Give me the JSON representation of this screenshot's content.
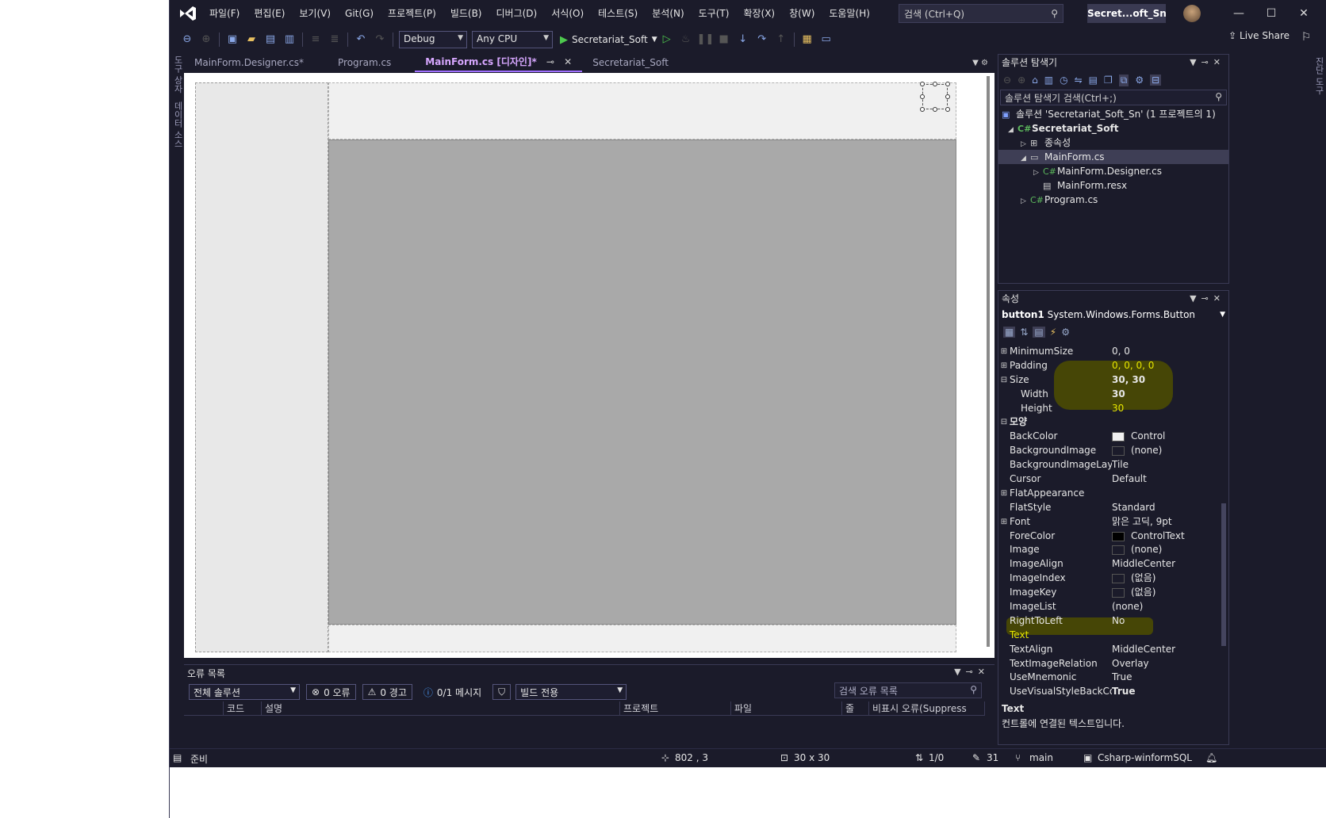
{
  "menubar": {
    "items": [
      "파일(F)",
      "편집(E)",
      "보기(V)",
      "Git(G)",
      "프로젝트(P)",
      "빌드(B)",
      "디버그(D)",
      "서식(O)",
      "테스트(S)",
      "분석(N)",
      "도구(T)",
      "확장(X)",
      "창(W)",
      "도움말(H)"
    ],
    "search_placeholder": "검색 (Ctrl+Q)",
    "solution_name": "Secret...oft_Sn"
  },
  "toolbar": {
    "configuration": "Debug",
    "platform": "Any CPU",
    "run_target": "Secretariat_Soft",
    "live_share": "Live Share"
  },
  "left_strip": {
    "toolbox": "도구 상자",
    "datasources": "데이터 소스"
  },
  "right_strip": {
    "tab": "진단 도구"
  },
  "doc_tabs": [
    {
      "label": "MainForm.Designer.cs*"
    },
    {
      "label": "Program.cs"
    },
    {
      "label": "MainForm.cs [디자인]*"
    },
    {
      "label": "Secretariat_Soft"
    }
  ],
  "error_list": {
    "title": "오류 목록",
    "scope": "전체 솔루션",
    "errors": "0 오류",
    "warnings": "0 경고",
    "messages": "0/1 메시지",
    "build_filter": "빌드 전용",
    "search_placeholder": "검색 오류 목록",
    "columns": [
      "코드",
      "설명",
      "프로젝트",
      "파일",
      "줄",
      "비표시 오류(Suppress"
    ]
  },
  "solution_explorer": {
    "title": "솔루션 탐색기",
    "search_placeholder": "솔루션 탐색기 검색(Ctrl+;)",
    "tree": [
      {
        "label": "솔루션 'Secretariat_Soft_Sn' (1 프로젝트의 1)",
        "icon": "solution-icon"
      },
      {
        "label": "Secretariat_Soft",
        "icon": "csharp-project-icon"
      },
      {
        "label": "종속성",
        "icon": "dependencies-icon"
      },
      {
        "label": "MainForm.cs",
        "icon": "form-icon"
      },
      {
        "label": "MainForm.Designer.cs",
        "icon": "csharp-file-icon"
      },
      {
        "label": "MainForm.resx",
        "icon": "resx-file-icon"
      },
      {
        "label": "Program.cs",
        "icon": "csharp-file-icon"
      }
    ]
  },
  "properties": {
    "title": "속성",
    "object_name": "button1",
    "object_type": "System.Windows.Forms.Button",
    "rows": [
      {
        "name": "MinimumSize",
        "value": "0, 0"
      },
      {
        "name": "Padding",
        "value": "0, 0, 0, 0"
      },
      {
        "name": "Size",
        "value": "30, 30"
      },
      {
        "name": "Width",
        "value": "30"
      },
      {
        "name": "Height",
        "value": "30"
      },
      {
        "name": "모양",
        "value": ""
      },
      {
        "name": "BackColor",
        "value": "Control"
      },
      {
        "name": "BackgroundImage",
        "value": "(none)"
      },
      {
        "name": "BackgroundImageLayout",
        "value": "Tile"
      },
      {
        "name": "Cursor",
        "value": "Default"
      },
      {
        "name": "FlatAppearance",
        "value": ""
      },
      {
        "name": "FlatStyle",
        "value": "Standard"
      },
      {
        "name": "Font",
        "value": "맑은 고딕, 9pt"
      },
      {
        "name": "ForeColor",
        "value": "ControlText"
      },
      {
        "name": "Image",
        "value": "(none)"
      },
      {
        "name": "ImageAlign",
        "value": "MiddleCenter"
      },
      {
        "name": "ImageIndex",
        "value": "(없음)"
      },
      {
        "name": "ImageKey",
        "value": "(없음)"
      },
      {
        "name": "ImageList",
        "value": "(none)"
      },
      {
        "name": "RightToLeft",
        "value": "No"
      },
      {
        "name": "Text",
        "value": ""
      },
      {
        "name": "TextAlign",
        "value": "MiddleCenter"
      },
      {
        "name": "TextImageRelation",
        "value": "Overlay"
      },
      {
        "name": "UseMnemonic",
        "value": "True"
      },
      {
        "name": "UseVisualStyleBackColor",
        "value": "True"
      }
    ],
    "description_title": "Text",
    "description_text": "컨트롤에 연결된 텍스트입니다."
  },
  "statusbar": {
    "ready": "준비",
    "position": "802 , 3",
    "size": "30 x 30",
    "changes": "1/0",
    "edits": "31",
    "branch": "main",
    "repo": "Csharp-winformSQL"
  },
  "colors": {
    "chrome_bg": "#1b1b2a",
    "accent": "#a070ff",
    "highlight_mark": "#4e4e00",
    "designer_main": "#a9a9a9"
  }
}
